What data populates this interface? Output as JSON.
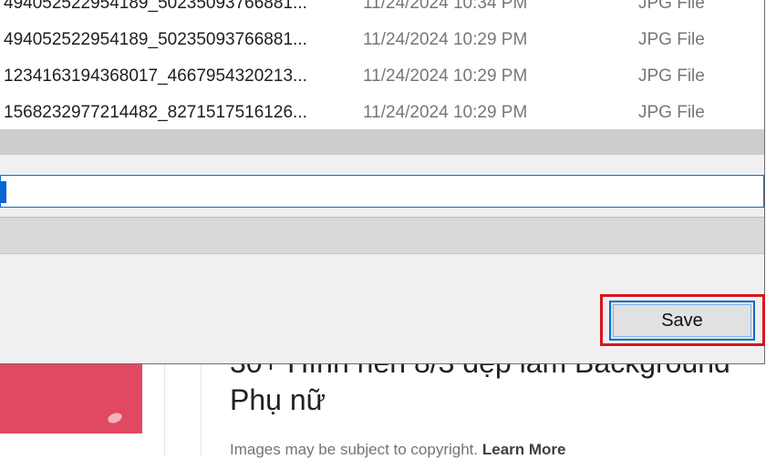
{
  "files": [
    {
      "name": "494052522954189_50235093766881...",
      "date": "11/24/2024 10:34 PM",
      "type": "JPG File"
    },
    {
      "name": "494052522954189_50235093766881...",
      "date": "11/24/2024 10:29 PM",
      "type": "JPG File"
    },
    {
      "name": "1234163194368017_4667954320213...",
      "date": "11/24/2024 10:29 PM",
      "type": "JPG File"
    },
    {
      "name": "1568232977214482_8271517516126...",
      "date": "11/24/2024 10:29 PM",
      "type": "JPG File"
    }
  ],
  "filename_input": {
    "value": ""
  },
  "save_button": {
    "label": "Save"
  },
  "background_result": {
    "title_line1": "30+ Hình nền 8/3 đẹp làm Background",
    "title_line2": "Phụ nữ",
    "copyright_text": "Images may be subject to copyright.",
    "learn_more": "Learn More"
  },
  "colors": {
    "highlight_border": "#d9151d",
    "focus_blue": "#0a6dd0",
    "thumbnail_pink": "#e14862"
  }
}
